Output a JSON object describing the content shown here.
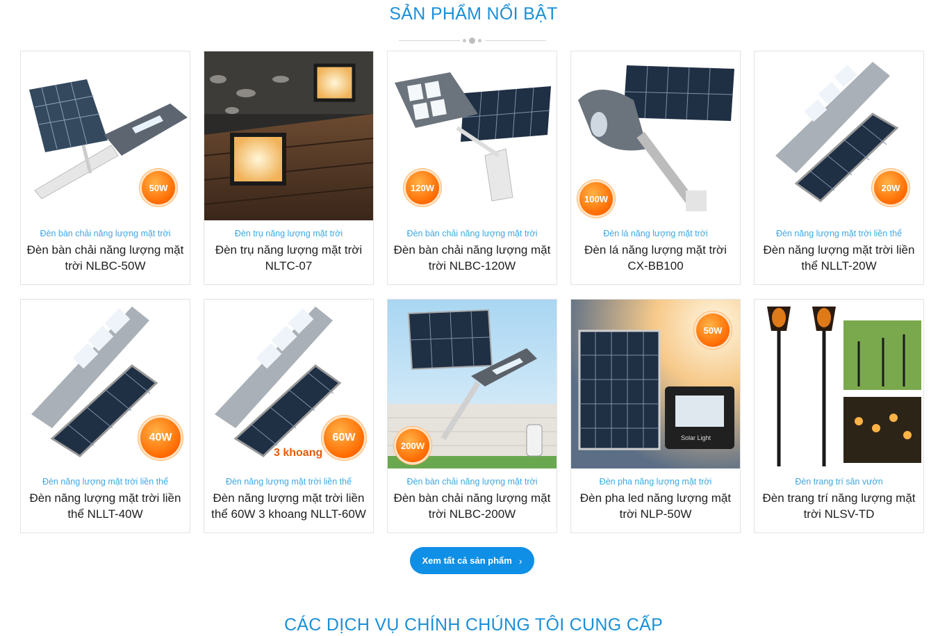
{
  "section_title": "SẢN PHẨM NỔI BẬT",
  "products": [
    {
      "category": "Đèn bàn chải năng lượng mặt trời",
      "name": "Đèn bàn chải năng lượng mặt trời NLBC-50W",
      "badge": "50W"
    },
    {
      "category": "Đèn trụ năng lượng mặt trời",
      "name": "Đèn trụ năng lượng mặt trời NLTC-07",
      "badge": ""
    },
    {
      "category": "Đèn bàn chải năng lượng mặt trời",
      "name": "Đèn bàn chải năng lượng mặt trời NLBC-120W",
      "badge": "120W"
    },
    {
      "category": "Đèn lá năng lượng mặt trời",
      "name": "Đèn lá năng lượng mặt trời CX-BB100",
      "badge": "100W"
    },
    {
      "category": "Đèn năng lượng mặt trời liền thể",
      "name": "Đèn năng lượng mặt trời liền thể NLLT-20W",
      "badge": "20W"
    },
    {
      "category": "Đèn năng lượng mặt trời liền thể",
      "name": "Đèn năng lượng mặt trời liền thể NLLT-40W",
      "badge": "40W"
    },
    {
      "category": "Đèn năng lượng mặt trời liền thể",
      "name": "Đèn năng lượng mặt trời liền thể 60W 3 khoang NLLT-60W",
      "badge": "60W",
      "extra_label": "3 khoang"
    },
    {
      "category": "Đèn bàn chải năng lượng mặt trời",
      "name": "Đèn bàn chải năng lượng mặt trời NLBC-200W",
      "badge": "200W"
    },
    {
      "category": "Đèn pha năng lượng mặt trời",
      "name": "Đèn pha led năng lượng mặt trời NLP-50W",
      "badge": "50W",
      "extra_label": "Solar Light"
    },
    {
      "category": "Đèn trang trí sân vườn",
      "name": "Đèn trang trí năng lượng mặt trời NLSV-TD",
      "badge": ""
    }
  ],
  "view_all_label": "Xem tất cả sản phẩm",
  "services_title": "CÁC DỊCH VỤ CHÍNH CHÚNG TÔI CUNG CẤP",
  "colors": {
    "accent": "#1a8fd8",
    "button": "#0f8fe6",
    "category": "#3fa7e3",
    "badge": "#ff6a00"
  },
  "icons": {
    "button_arrow": "chevron-right-icon"
  }
}
